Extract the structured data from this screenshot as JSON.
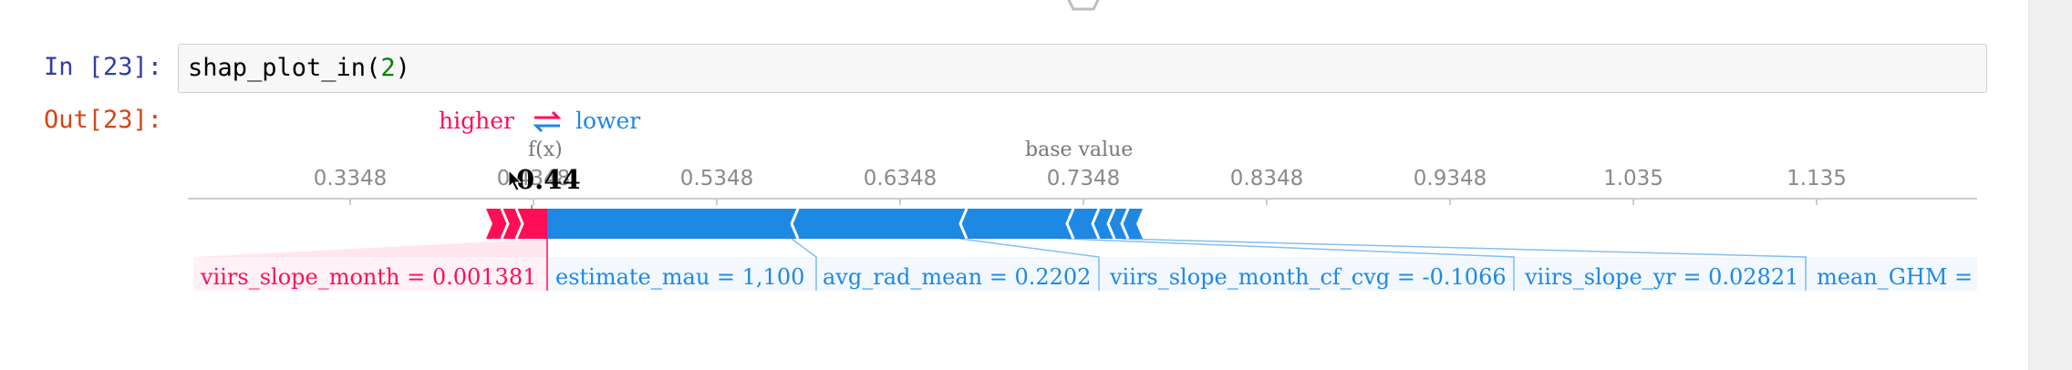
{
  "cell": {
    "in_prompt": "In [23]:",
    "out_prompt": "Out[23]:",
    "code_func": "shap_plot_in(",
    "code_arg": "2",
    "code_close": ")"
  },
  "plot": {
    "legend_higher": "higher",
    "legend_lower": "lower",
    "fx_label": "f(x)",
    "fx_value": "0.44",
    "base_label": "base value",
    "ticks": [
      "0.3348",
      "0.4348",
      "0.5348",
      "0.6348",
      "0.7348",
      "0.8348",
      "0.9348",
      "1.035",
      "1.135"
    ],
    "colors": {
      "positive": "#ff0d57",
      "negative": "#1e88e5"
    },
    "features": [
      {
        "text": "viirs_slope_month = 0.001381",
        "effect": "positive"
      },
      {
        "text": "estimate_mau = 1,100",
        "effect": "negative"
      },
      {
        "text": "avg_rad_mean = 0.2202",
        "effect": "negative"
      },
      {
        "text": "viirs_slope_month_cf_cvg = -0.1066",
        "effect": "negative"
      },
      {
        "text": "viirs_slope_yr = 0.02821",
        "effect": "negative"
      },
      {
        "text": "mean_GHM =",
        "effect": "negative"
      }
    ]
  }
}
